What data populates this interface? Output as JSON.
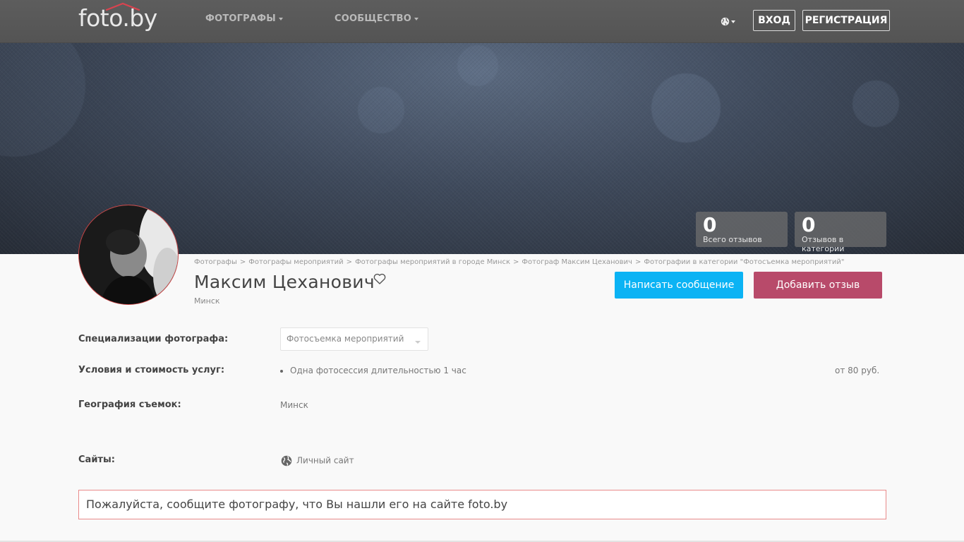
{
  "nav": {
    "logo": "foto.by",
    "menu": [
      {
        "label": "ФОТОГРАФЫ"
      },
      {
        "label": "СООБЩЕСТВО"
      }
    ],
    "language_icon": "globe-icon",
    "login_label": "ВХОД",
    "register_label": "РЕГИСТРАЦИЯ"
  },
  "stats": [
    {
      "value": "0",
      "label": "Всего отзывов"
    },
    {
      "value": "0",
      "label": "Отзывов в категории"
    }
  ],
  "breadcrumb": [
    "Фотографы",
    "Фотографы мероприятий",
    "Фотографы мероприятий в городе Минск",
    "Фотограф Максим Цеханович",
    "Фотографии в категории \"Фотосъемка мероприятий\""
  ],
  "breadcrumb_separator": ">",
  "profile": {
    "name": "Максим Цеханович",
    "city": "Минск",
    "message_button": "Написать сообщение",
    "review_button": "Добавить отзыв"
  },
  "details": {
    "specializations_label": "Специализации фотографа:",
    "specialization_selected": "Фотосъемка мероприятий",
    "services_label": "Условия и стоимость услуг:",
    "service_name": "Одна фотосессия длительностью 1 час",
    "service_price": "от 80 руб.",
    "geography_label": "География съемок:",
    "geography_value": "Минск",
    "sites_label": "Сайты:",
    "site_link": "Личный сайт"
  },
  "notice": "Пожалуйста, сообщите фотографу, что Вы нашли его на сайте foto.by",
  "colors": {
    "message_button": "#0bb3f4",
    "review_button": "#b84a6a",
    "notice_border": "#e98a8a"
  }
}
